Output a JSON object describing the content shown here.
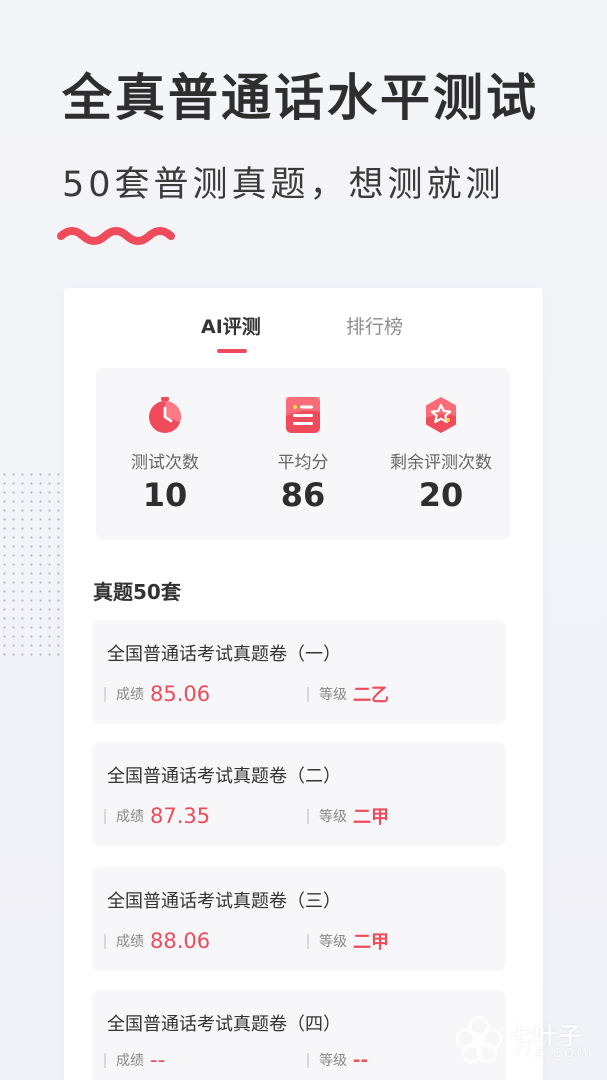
{
  "hero": {
    "title": "全真普通话水平测试",
    "subtitle": "50套普测真题，想测就测"
  },
  "tabs": [
    {
      "label": "AI评测",
      "active": true
    },
    {
      "label": "排行榜",
      "active": false
    }
  ],
  "stats": [
    {
      "icon": "stopwatch-icon",
      "label": "测试次数",
      "value": "10"
    },
    {
      "icon": "notepad-icon",
      "label": "平均分",
      "value": "86"
    },
    {
      "icon": "star-badge-icon",
      "label": "剩余评测次数",
      "value": "20"
    }
  ],
  "section_title": "真题50套",
  "exams": [
    {
      "title": "全国普通话考试真题卷（一）",
      "score_label": "成绩",
      "score": "85.06",
      "level_label": "等级",
      "level": "二乙"
    },
    {
      "title": "全国普通话考试真题卷（二）",
      "score_label": "成绩",
      "score": "87.35",
      "level_label": "等级",
      "level": "二甲"
    },
    {
      "title": "全国普通话考试真题卷（三）",
      "score_label": "成绩",
      "score": "88.06",
      "level_label": "等级",
      "level": "二甲"
    },
    {
      "title": "全国普通话考试真题卷（四）",
      "score_label": "成绩",
      "score": "--",
      "level_label": "等级",
      "level": "--"
    }
  ],
  "watermark": {
    "name": "七叶子",
    "domain": "7YZ.COM"
  },
  "colors": {
    "accent": "#ef4b5b",
    "accent_light": "#ff7a84",
    "text_dark": "#2e2e2e",
    "card_bg": "#f7f7f9"
  }
}
